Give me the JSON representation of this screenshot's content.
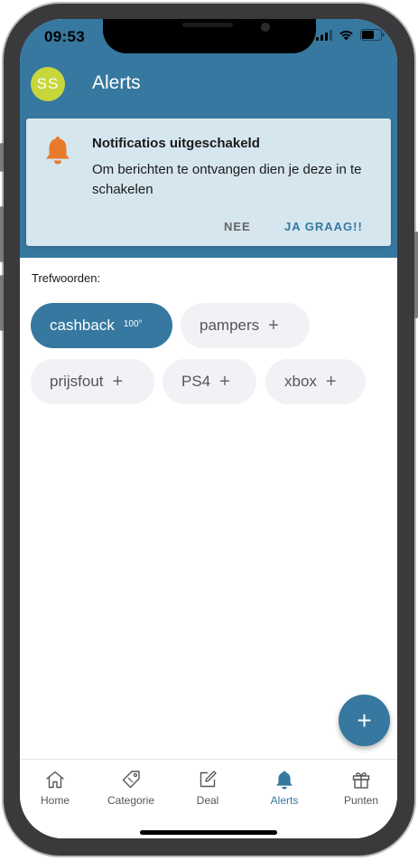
{
  "status_bar": {
    "time": "09:53"
  },
  "header": {
    "avatar_initials": "SS",
    "title": "Alerts"
  },
  "banner": {
    "title": "Notificatios uitgeschakeld",
    "message": "Om berichten te ontvangen dien je deze in te schakelen",
    "decline_label": "NEE",
    "accept_label": "JA GRAAG!!"
  },
  "keywords": {
    "label": "Trefwoorden:",
    "chips": [
      {
        "label": "cashback",
        "count": "100°",
        "active": true
      },
      {
        "label": "pampers",
        "plus": "+"
      },
      {
        "label": "prijsfout",
        "plus": "+"
      },
      {
        "label": "PS4",
        "plus": "+"
      },
      {
        "label": "xbox",
        "plus": "+"
      }
    ]
  },
  "fab": {
    "icon": "plus-icon",
    "symbol": "+"
  },
  "tabbar": {
    "items": [
      {
        "label": "Home",
        "icon": "home-icon"
      },
      {
        "label": "Categorie",
        "icon": "tag-icon"
      },
      {
        "label": "Deal",
        "icon": "edit-icon"
      },
      {
        "label": "Alerts",
        "icon": "bell-icon",
        "active": true
      },
      {
        "label": "Punten",
        "icon": "gift-icon"
      }
    ]
  },
  "colors": {
    "brand": "#36789f",
    "avatar": "#c7d63a",
    "bell": "#e87a2c",
    "banner_bg": "#d5e6ef"
  }
}
